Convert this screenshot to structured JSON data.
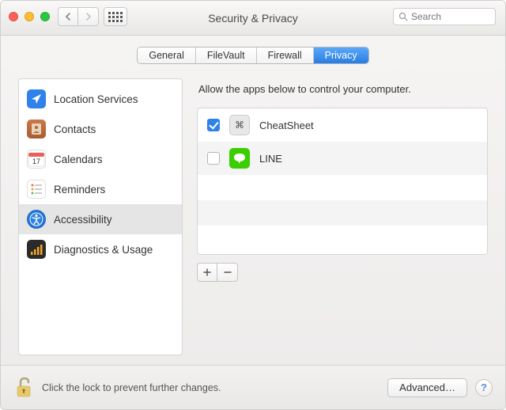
{
  "window": {
    "title": "Security & Privacy"
  },
  "search": {
    "placeholder": "Search"
  },
  "tabs": [
    {
      "label": "General",
      "active": false
    },
    {
      "label": "FileVault",
      "active": false
    },
    {
      "label": "Firewall",
      "active": false
    },
    {
      "label": "Privacy",
      "active": true
    }
  ],
  "sidebar": {
    "items": [
      {
        "label": "Location Services",
        "icon": "location",
        "selected": false
      },
      {
        "label": "Contacts",
        "icon": "contacts",
        "selected": false
      },
      {
        "label": "Calendars",
        "icon": "calendar",
        "selected": false,
        "badge": "17"
      },
      {
        "label": "Reminders",
        "icon": "reminders",
        "selected": false
      },
      {
        "label": "Accessibility",
        "icon": "accessibility",
        "selected": true
      },
      {
        "label": "Diagnostics & Usage",
        "icon": "diagnostics",
        "selected": false
      }
    ]
  },
  "right": {
    "instruction": "Allow the apps below to control your computer.",
    "apps": [
      {
        "name": "CheatSheet",
        "checked": true,
        "icon": "cheatsheet"
      },
      {
        "name": "LINE",
        "checked": false,
        "icon": "line"
      }
    ]
  },
  "footer": {
    "lock_text": "Click the lock to prevent further changes.",
    "advanced_label": "Advanced…"
  }
}
